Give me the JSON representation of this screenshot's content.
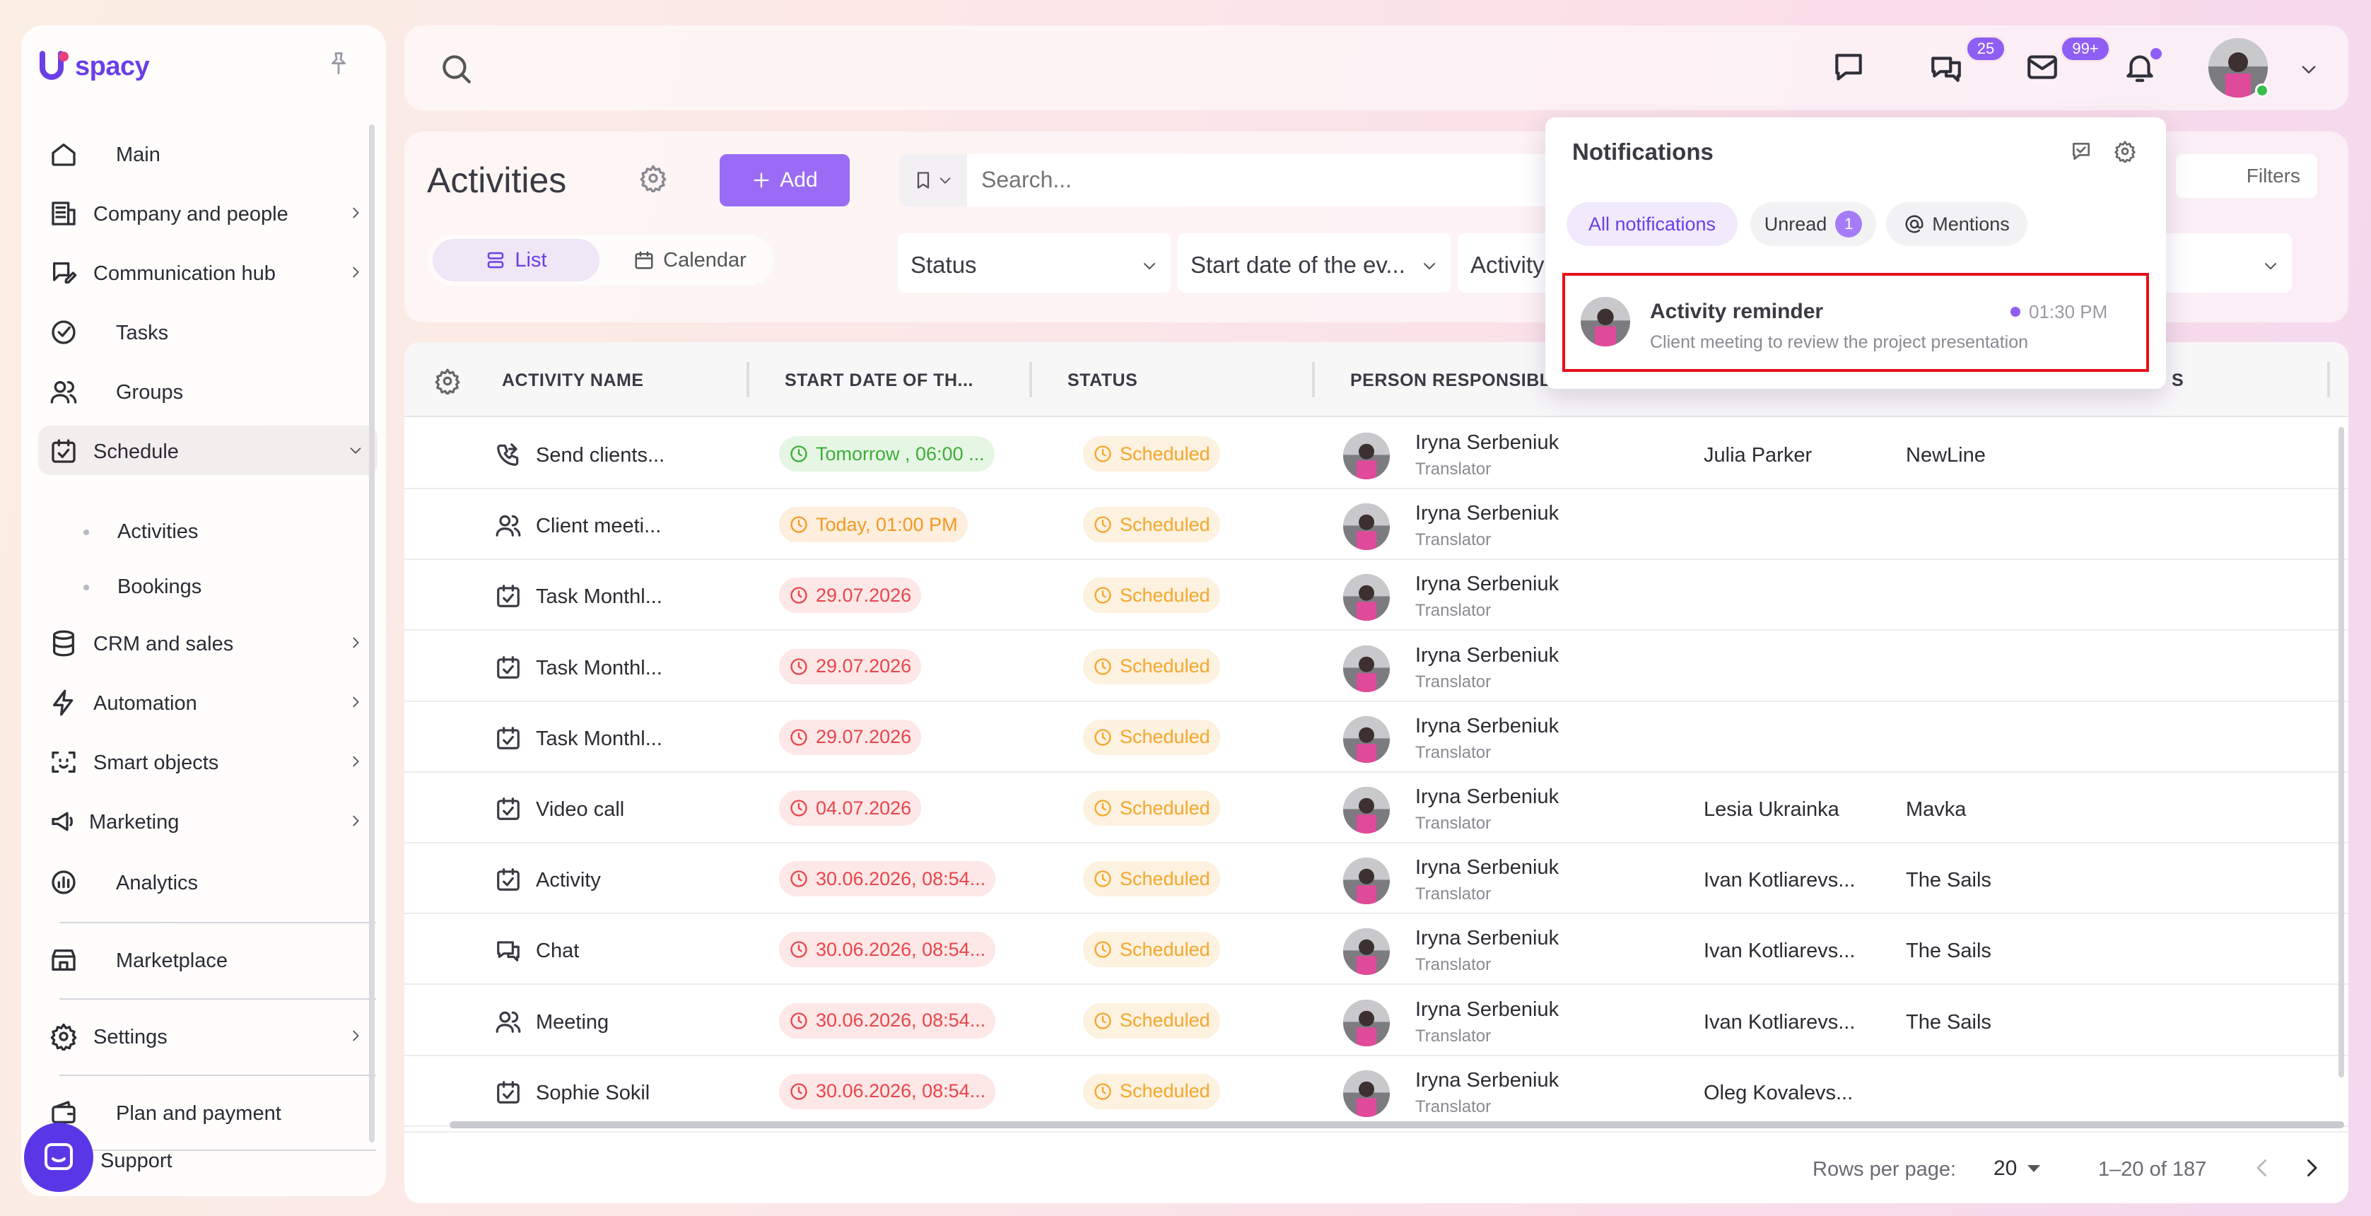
{
  "app": {
    "logo_text": "spacy"
  },
  "sidebar": {
    "items": [
      {
        "label": "Main",
        "icon": "home-icon"
      },
      {
        "label": "Company and people",
        "icon": "building-icon"
      },
      {
        "label": "Communication hub",
        "icon": "chat-edit-icon"
      },
      {
        "label": "Tasks",
        "icon": "check-circle-icon"
      },
      {
        "label": "Groups",
        "icon": "users-icon"
      },
      {
        "label": "Schedule",
        "icon": "calendar-check-icon"
      },
      {
        "label": "CRM and sales",
        "icon": "database-icon"
      },
      {
        "label": "Automation",
        "icon": "lightning-icon"
      },
      {
        "label": "Smart objects",
        "icon": "scan-face-icon"
      },
      {
        "label": "Marketing",
        "icon": "megaphone-icon"
      },
      {
        "label": "Analytics",
        "icon": "chart-circle-icon"
      },
      {
        "label": "Marketplace",
        "icon": "store-icon"
      },
      {
        "label": "Settings",
        "icon": "gear-icon"
      },
      {
        "label": "Plan and payment",
        "icon": "wallet-icon"
      },
      {
        "label": "Support",
        "icon": "chat-bubble-icon"
      }
    ],
    "schedule_sub": [
      "Activities",
      "Bookings"
    ]
  },
  "topbar": {
    "chat_badge": "25",
    "mail_badge": "99+"
  },
  "page": {
    "title": "Activities",
    "add_label": "Add",
    "view_list": "List",
    "view_calendar": "Calendar",
    "search_placeholder": "Search...",
    "filters_label": "Filters",
    "filter_status": "Status",
    "filter_start": "Start date of the ev...",
    "filter_activity": "Activity"
  },
  "table": {
    "columns": [
      "ACTIVITY NAME",
      "START DATE OF TH...",
      "STATUS",
      "PERSON RESPONSIBLE",
      "S"
    ],
    "rows": [
      {
        "icon": "phone-icon",
        "name": "Send clients...",
        "date": "Tomorrow , 06:00 ...",
        "date_color": "green",
        "status": "Scheduled",
        "person": "Iryna Serbeniuk",
        "role": "Translator",
        "contact": "Julia Parker",
        "company": "NewLine"
      },
      {
        "icon": "users-icon",
        "name": "Client meeti...",
        "date": "Today, 01:00 PM",
        "date_color": "orange",
        "status": "Scheduled",
        "person": "Iryna Serbeniuk",
        "role": "Translator",
        "contact": "",
        "company": ""
      },
      {
        "icon": "calendar-check-icon",
        "name": "Task Monthl...",
        "date": "29.07.2026",
        "date_color": "red",
        "status": "Scheduled",
        "person": "Iryna Serbeniuk",
        "role": "Translator",
        "contact": "",
        "company": ""
      },
      {
        "icon": "calendar-check-icon",
        "name": "Task Monthl...",
        "date": "29.07.2026",
        "date_color": "red",
        "status": "Scheduled",
        "person": "Iryna Serbeniuk",
        "role": "Translator",
        "contact": "",
        "company": ""
      },
      {
        "icon": "calendar-check-icon",
        "name": "Task Monthl...",
        "date": "29.07.2026",
        "date_color": "red",
        "status": "Scheduled",
        "person": "Iryna Serbeniuk",
        "role": "Translator",
        "contact": "",
        "company": ""
      },
      {
        "icon": "calendar-check-icon",
        "name": "Video call",
        "date": "04.07.2026",
        "date_color": "red",
        "status": "Scheduled",
        "person": "Iryna Serbeniuk",
        "role": "Translator",
        "contact": "Lesia Ukrainka",
        "company": "Mavka"
      },
      {
        "icon": "calendar-check-icon",
        "name": "Activity",
        "date": "30.06.2026, 08:54...",
        "date_color": "red",
        "status": "Scheduled",
        "person": "Iryna Serbeniuk",
        "role": "Translator",
        "contact": "Ivan Kotliarevs...",
        "company": "The Sails"
      },
      {
        "icon": "chat-icon",
        "name": "Chat",
        "date": "30.06.2026, 08:54...",
        "date_color": "red",
        "status": "Scheduled",
        "person": "Iryna Serbeniuk",
        "role": "Translator",
        "contact": "Ivan Kotliarevs...",
        "company": "The Sails"
      },
      {
        "icon": "users-icon",
        "name": "Meeting",
        "date": "30.06.2026, 08:54...",
        "date_color": "red",
        "status": "Scheduled",
        "person": "Iryna Serbeniuk",
        "role": "Translator",
        "contact": "Ivan Kotliarevs...",
        "company": "The Sails"
      },
      {
        "icon": "calendar-check-icon",
        "name": "Sophie Sokil",
        "date": "30.06.2026, 08:54...",
        "date_color": "red",
        "status": "Scheduled",
        "person": "Iryna Serbeniuk",
        "role": "Translator",
        "contact": "Oleg Kovalevs...",
        "company": ""
      }
    ]
  },
  "pagination": {
    "rows_per_page_label": "Rows per page:",
    "rows_per_page": "20",
    "range": "1–20 of 187"
  },
  "notifications": {
    "title": "Notifications",
    "tab_all": "All notifications",
    "tab_unread": "Unread",
    "unread_count": "1",
    "tab_mentions": "Mentions",
    "item": {
      "title": "Activity reminder",
      "text": "Client meeting to review the project presentation",
      "time": "01:30 PM"
    }
  },
  "colors": {
    "accent": "#8f5ef5",
    "highlight_border": "#e5101a"
  }
}
